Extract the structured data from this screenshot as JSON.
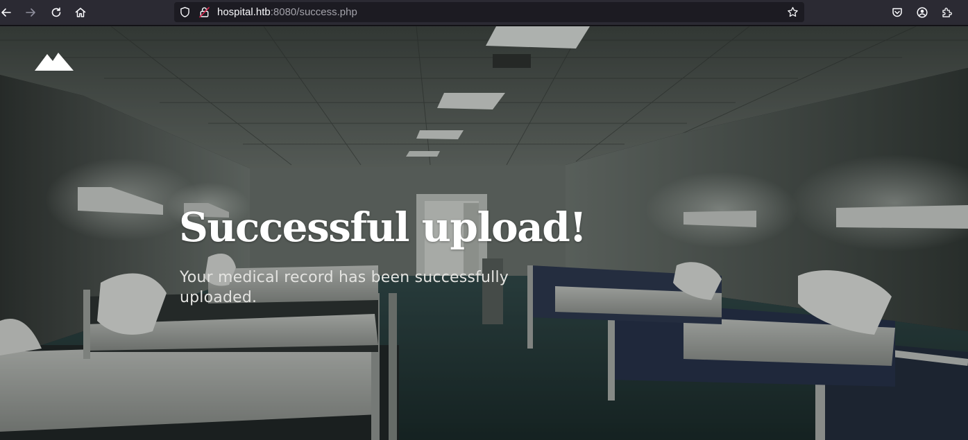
{
  "browser": {
    "url_host": "hospital.htb",
    "url_rest": ":8080/success.php",
    "icons": {
      "back": "arrow-left-icon",
      "forward": "arrow-right-icon",
      "reload": "reload-icon",
      "home": "home-icon",
      "tracking": "shield-icon",
      "security": "lock-insecure-icon",
      "bookmark": "star-icon",
      "pocket": "pocket-icon",
      "account": "account-icon",
      "extensions": "puzzle-icon"
    }
  },
  "page": {
    "logo_icon": "mountain-logo-icon",
    "title": "Successful upload!",
    "subtitle": "Your medical record has been successfully uploaded."
  },
  "colors": {
    "chrome_bg": "#2b2a33",
    "urlbar_bg": "#1c1b22",
    "title_color": "#ffffff",
    "subtitle_color": "#e3e3e0"
  }
}
